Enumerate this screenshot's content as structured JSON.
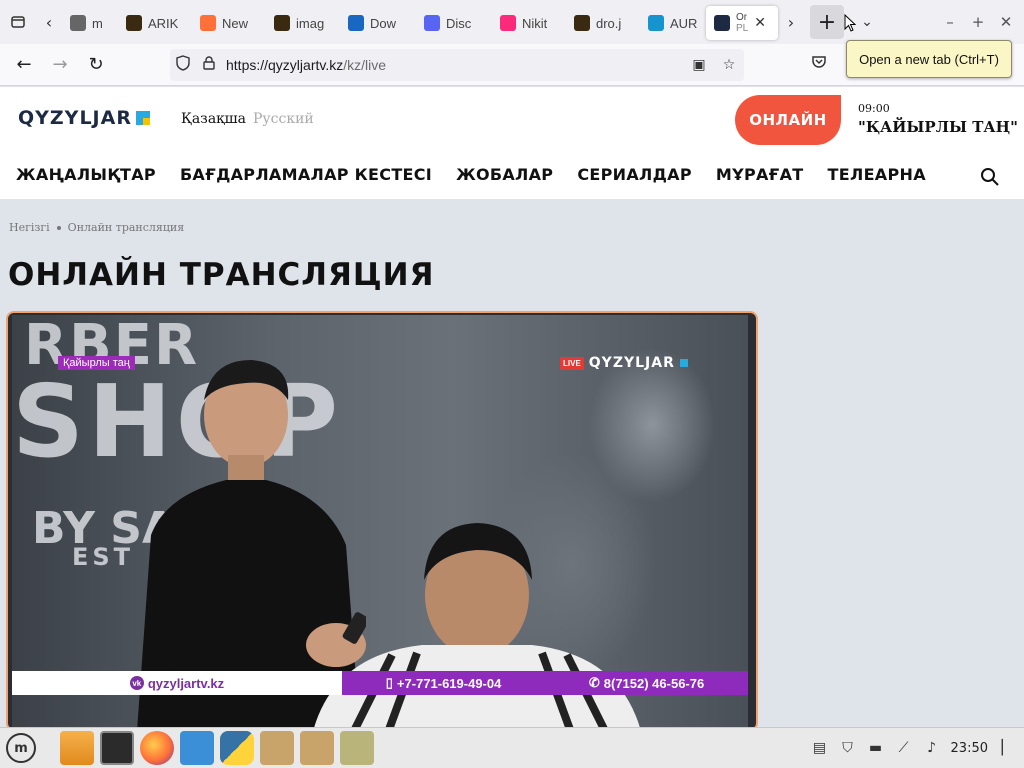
{
  "browser": {
    "tabs": [
      {
        "label": "m",
        "favicon": "hamburger",
        "color": "#666666"
      },
      {
        "label": "ARIK",
        "favicon": "image-thumb",
        "color": "#3a2a10"
      },
      {
        "label": "New",
        "favicon": "firefox",
        "color": "#ff7139"
      },
      {
        "label": "imag",
        "favicon": "image-thumb",
        "color": "#3a2a10"
      },
      {
        "label": "Dow",
        "favicon": "vuetify",
        "color": "#1867c0"
      },
      {
        "label": "Disc",
        "favicon": "discord",
        "color": "#5865f2"
      },
      {
        "label": "Nikit",
        "favicon": "tinder-flame",
        "color": "#fd297b"
      },
      {
        "label": "dro.j",
        "favicon": "image-thumb",
        "color": "#3a2a10"
      },
      {
        "label": "AUR",
        "favicon": "arch",
        "color": "#1793d1"
      }
    ],
    "active_tab": {
      "label": "Or\nPL",
      "line1": "Or",
      "line2": "PL"
    },
    "url": {
      "domain": "https://qyzyljartv.kz",
      "path": "/kz/live"
    },
    "tooltip": "Open a new tab (Ctrl+T)"
  },
  "site": {
    "logo": "QYZYLJAR",
    "lang_kz": "Қазақша",
    "lang_ru": "Русский",
    "online_button": "ОНЛАЙН",
    "program_time": "09:00",
    "program_title": "\"ҚАЙЫРЛЫ ТАҢ\"",
    "nav": [
      "ЖАҢАЛЫҚТАР",
      "БАҒДАРЛАМАЛАР КЕСТЕСІ",
      "ЖОБАЛАР",
      "СЕРИАЛДАР",
      "МҰРАҒАТ",
      "ТЕЛЕАРНА"
    ],
    "breadcrumb": {
      "home": "Негізгі",
      "current": "Онлайн трансляция"
    },
    "page_title": "ОНЛАЙН ТРАНСЛЯЦИЯ"
  },
  "video": {
    "background_text": [
      "RBER",
      "SHOP",
      "BY SA",
      "EST"
    ],
    "show_tag": "Қайырлы таң",
    "live_badge": "LIVE",
    "channel_logo": "QYZYLJAR",
    "ticker": {
      "website": "qyzyljartv.kz",
      "phone1": "+7-771-619-49-04",
      "phone2": "8(7152) 46-56-76"
    }
  },
  "taskbar": {
    "clock": "23:50",
    "launchers": [
      "files-icon",
      "terminal-icon",
      "firefox-icon",
      "snowflake-icon",
      "python-icon",
      "archive-icon",
      "archive-icon",
      "archive-installer-icon"
    ]
  },
  "colors": {
    "accent": "#f2553d",
    "purple": "#8e2bbd",
    "page_bg": "#dfe4ea"
  }
}
